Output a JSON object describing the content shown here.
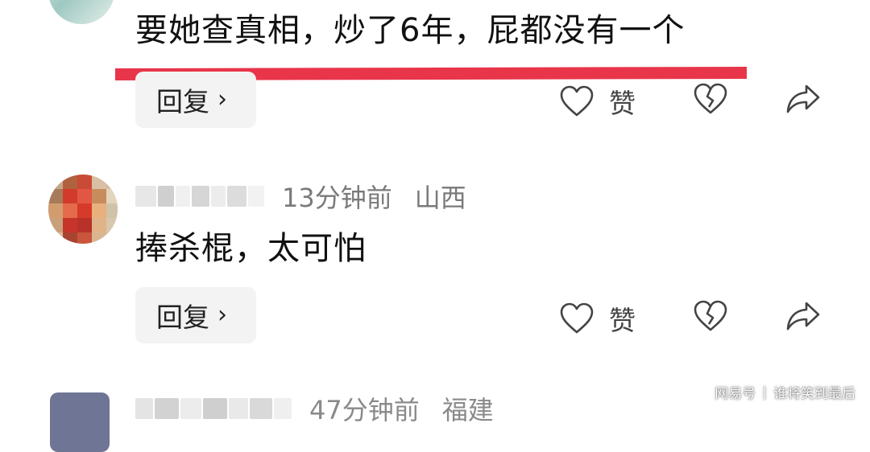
{
  "comments": [
    {
      "text": "要她查真相，炒了6年，屁都没有一个",
      "reply_label": "回复",
      "like_label": "赞"
    },
    {
      "time": "13分钟前",
      "location": "山西",
      "text": "捧杀棍，太可怕",
      "reply_label": "回复",
      "like_label": "赞"
    },
    {
      "time": "47分钟前",
      "location": "福建"
    }
  ],
  "icons": {
    "reply_chevron": "chevron-right-icon",
    "like": "heart-icon",
    "dislike": "broken-heart-icon",
    "share": "share-arrow-icon"
  },
  "colors": {
    "underline": "#e8354a",
    "reply_bg": "#f3f3f3",
    "meta_text": "#7a7a7a"
  },
  "watermark": {
    "brand": "网易号",
    "author": "谁将笑到最后"
  }
}
